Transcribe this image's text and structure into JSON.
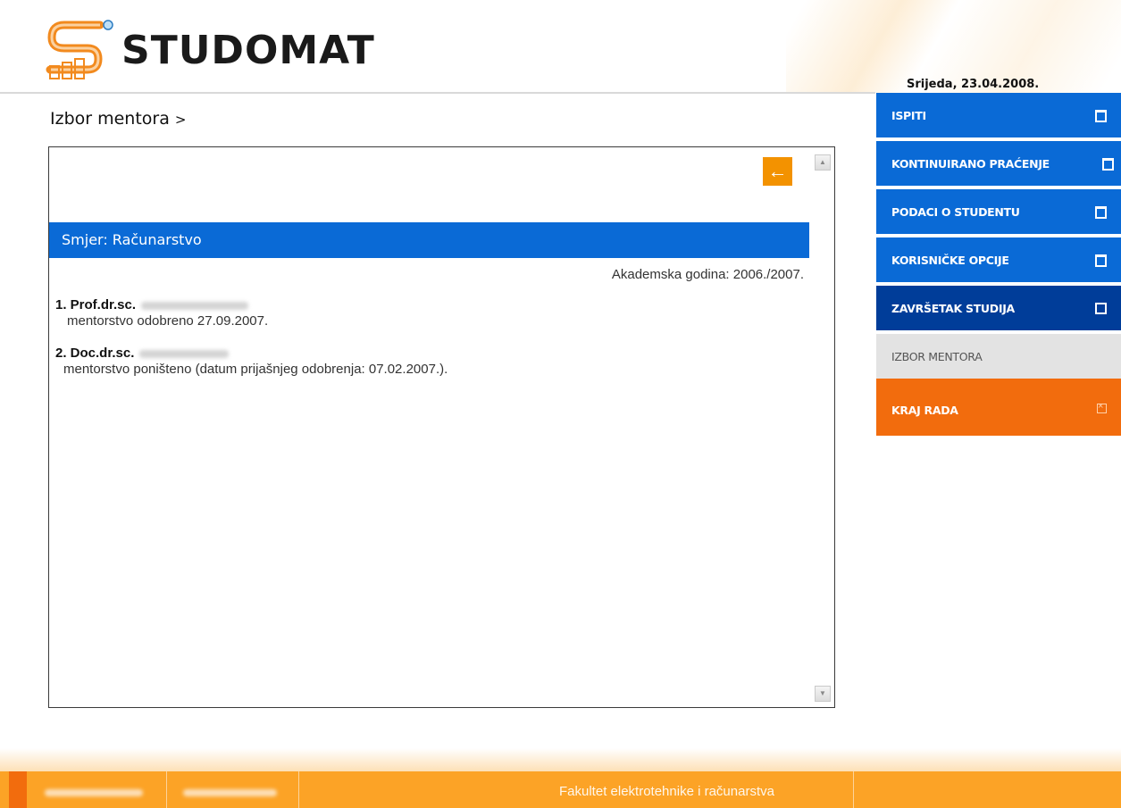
{
  "header": {
    "logo_text": "STUDOMAT",
    "date": "Srijeda, 23.04.2008."
  },
  "breadcrumb": {
    "title": "Izbor mentora",
    "separator": ">"
  },
  "content": {
    "back_icon": "arrow-left-icon",
    "smjer": "Smjer: Računarstvo",
    "akademska_godina": "Akademska godina: 2006./2007.",
    "entries": [
      {
        "title": "1. Prof.dr.sc.",
        "status": "mentorstvo odobreno 27.09.2007."
      },
      {
        "title": "2. Doc.dr.sc.",
        "status": "mentorstvo poništeno (datum prijašnjeg odobrenja: 07.02.2007.)."
      }
    ]
  },
  "menu": {
    "items": [
      {
        "label": "ISPITI"
      },
      {
        "label": "KONTINUIRANO PRAĆENJE"
      },
      {
        "label": "PODACI O STUDENTU"
      },
      {
        "label": "KORISNIČKE OPCIJE"
      },
      {
        "label": "ZAVRŠETAK STUDIJA"
      },
      {
        "label": "IZBOR MENTORA"
      },
      {
        "label": "KRAJ RADA"
      }
    ]
  },
  "footer": {
    "faculty": "Fakultet elektrotehnike i računarstva"
  },
  "colors": {
    "menu_blue": "#0a6ad6",
    "menu_dark_blue": "#003d99",
    "accent_orange": "#f26c0d",
    "footer_orange": "#fca326"
  }
}
